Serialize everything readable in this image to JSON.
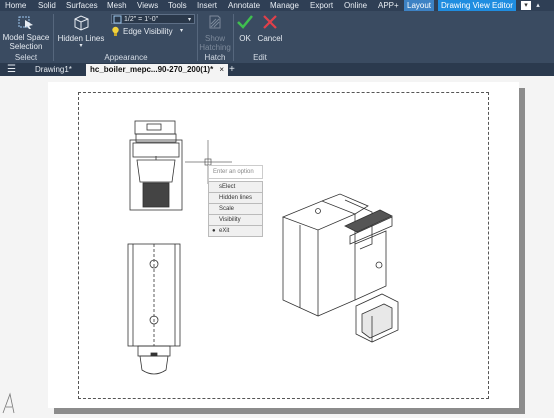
{
  "menubar": {
    "items": [
      "Home",
      "Solid",
      "Surfaces",
      "Mesh",
      "Views",
      "Tools",
      "Insert",
      "Annotate",
      "Manage",
      "Export",
      "Online",
      "APP+",
      "Layout"
    ],
    "active_editor": "Drawing View Editor"
  },
  "ribbon": {
    "model_space_label_1": "Model Space",
    "model_space_label_2": "Selection",
    "select_group": "Select",
    "hidden_lines_label": "Hidden Lines",
    "scale_value": "1/2\" = 1'-0\"",
    "edge_visibility_label": "Edge Visibility",
    "appearance_group": "Appearance",
    "show_hatching_1": "Show",
    "show_hatching_2": "Hatching",
    "hatch_group": "Hatch",
    "ok_label": "OK",
    "cancel_label": "Cancel",
    "edit_group": "Edit"
  },
  "tabs": {
    "items": [
      {
        "label": "Drawing1*",
        "active": false
      },
      {
        "label": "hc_boiler_mepc...90-270_200(1)*",
        "active": true
      }
    ],
    "close_symbol": "×",
    "add_symbol": "+"
  },
  "context_menu": {
    "prompt": "Enter an option",
    "items": [
      "sElect",
      "Hidden lines",
      "Scale",
      "Visibility",
      "eXit"
    ],
    "bullet_item": "eXit",
    "bullet": "●"
  },
  "colors": {
    "menubar_bg": "#2f3f55",
    "ribbon_bg": "#3a4b61",
    "tab_active": "#1f8de0",
    "ok_green": "#3fbf4f",
    "cancel_red": "#e0404a"
  }
}
